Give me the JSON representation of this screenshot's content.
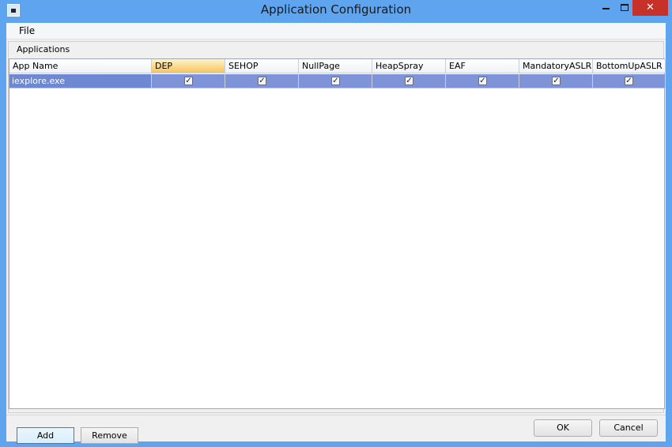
{
  "window": {
    "title": "Application Configuration",
    "close_glyph": "✕"
  },
  "menu": {
    "file": "File"
  },
  "applications": {
    "label": "Applications",
    "columns": [
      "App Name",
      "DEP",
      "SEHOP",
      "NullPage",
      "HeapSpray",
      "EAF",
      "MandatoryASLR",
      "BottomUpASLR"
    ],
    "active_column": "DEP",
    "rows": [
      {
        "app_name": "iexplore.exe",
        "checks": [
          true,
          true,
          true,
          true,
          true,
          true,
          true
        ],
        "selected": true
      }
    ],
    "check_glyph": "✓"
  },
  "buttons": {
    "add": "Add",
    "remove": "Remove",
    "ok": "OK",
    "cancel": "Cancel"
  },
  "colors": {
    "titlebar": "#5ea4ef",
    "close": "#c7312a",
    "selection": "#7e93d8",
    "active_header": "#f6c45f"
  }
}
